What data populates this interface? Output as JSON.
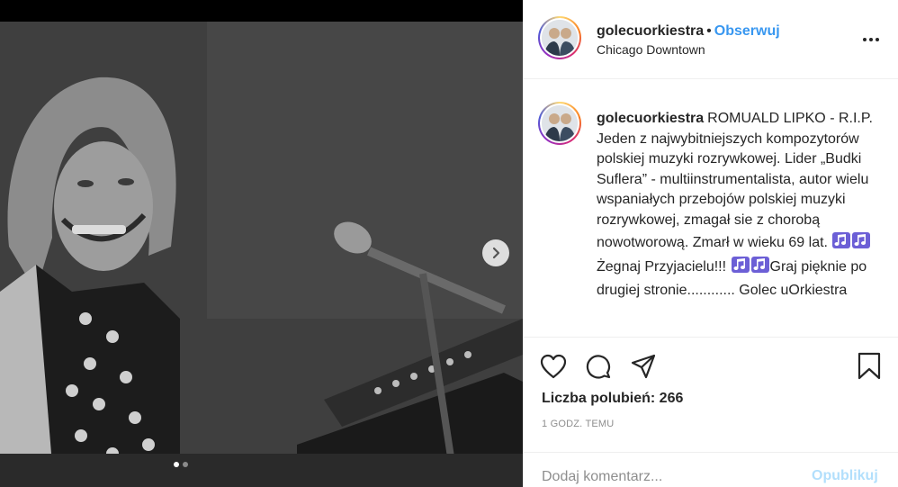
{
  "post": {
    "username": "golecuorkiestra",
    "separator": "•",
    "follow_label": "Obserwuj",
    "location": "Chicago Downtown",
    "caption_text_1": "ROMUALD LIPKO - R.I.P. Jeden z najwybitniejszych kompozytorów polskiej muzyki rozrywkowej. Lider „Budki Suflera” - multiinstrumentalista, autor wielu wspaniałych przebojów polskiej muzyki rozrywkowej, zmagał sie z chorobą nowotworową. Zmarł w wieku 69 lat. ",
    "caption_text_2": "Żegnaj Przyjacielu!!! ",
    "caption_text_3": "Graj pięknie po drugiej stronie............ Golec uOrkiestra",
    "likes_label": "Liczba polubień: 266",
    "timestamp": "1 GODZ. TEMU"
  },
  "comment": {
    "placeholder": "Dodaj komentarz...",
    "publish_label": "Opublikuj"
  },
  "carousel": {
    "slide_count": 2,
    "active_index": 0
  },
  "icons": {
    "more": "more-options-icon",
    "next": "chevron-right-icon",
    "like": "heart-icon",
    "comment": "comment-icon",
    "share": "share-icon",
    "save": "bookmark-icon",
    "emoji": "music-notes-icon"
  },
  "colors": {
    "link_blue": "#3897f0",
    "publish_disabled": "#b2dffc",
    "muted_text": "#8e8e8e",
    "note_purple": "#6c5fd6"
  }
}
